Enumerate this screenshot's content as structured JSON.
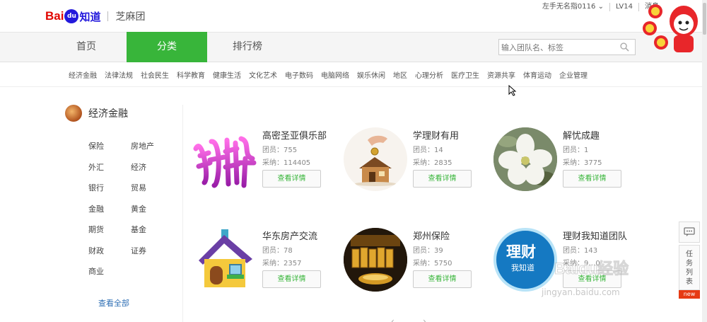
{
  "header": {
    "logo_bai": "Bai",
    "logo_du": "du",
    "logo_zhidao": "知道",
    "product": "芝麻团",
    "username": "左手无名指0116",
    "level": "LV14",
    "messages": "消息"
  },
  "nav": {
    "tabs": [
      {
        "label": "首页",
        "active": false
      },
      {
        "label": "分类",
        "active": true
      },
      {
        "label": "排行榜",
        "active": false
      }
    ],
    "search_placeholder": "输入团队名、标签"
  },
  "categories": [
    "经济金融",
    "法律法规",
    "社会民生",
    "科学教育",
    "健康生活",
    "文化艺术",
    "电子数码",
    "电脑网络",
    "娱乐休闲",
    "地区",
    "心理分析",
    "医疗卫生",
    "资源共享",
    "体育运动",
    "企业管理"
  ],
  "sidebar": {
    "title": "经济金融",
    "subcategories": [
      "保险",
      "房地产",
      "外汇",
      "经济",
      "银行",
      "贸易",
      "金融",
      "黄金",
      "期货",
      "基金",
      "财政",
      "证券",
      "商业"
    ],
    "view_all": "查看全部"
  },
  "teams": [
    {
      "name": "高密圣亚俱乐部",
      "members": "团员：755",
      "adopted": "采纳：114405",
      "button": "查看详情",
      "image": "pink-text-logo"
    },
    {
      "name": "学理财有用",
      "members": "团员：14",
      "adopted": "采纳：2835",
      "button": "查看详情",
      "image": "coin-house"
    },
    {
      "name": "解忧成趣",
      "members": "团员：1",
      "adopted": "采纳：3775",
      "button": "查看详情",
      "image": "white-flower"
    },
    {
      "name": "华东房产交流",
      "members": "团员：78",
      "adopted": "采纳：2357",
      "button": "查看详情",
      "image": "cartoon-house"
    },
    {
      "name": "郑州保险",
      "members": "团员：39",
      "adopted": "采纳：5750",
      "button": "查看详情",
      "image": "gold-bars"
    },
    {
      "name": "理财我知道团队",
      "members": "团员：143",
      "adopted": "采纳：9…0",
      "button": "查看详情",
      "image": "licai-logo",
      "logo_big": "理财",
      "logo_small": "我知道"
    }
  ],
  "floating": {
    "task_label": [
      "任",
      "务",
      "列",
      "表"
    ],
    "new_badge": "new"
  },
  "watermark": {
    "brand": "Baidu经验",
    "url": "jingyan.baidu.com"
  },
  "colors": {
    "accent": "#38b53a",
    "brand_red": "#e10601",
    "brand_blue": "#2319dc",
    "link": "#2f6fb5"
  }
}
